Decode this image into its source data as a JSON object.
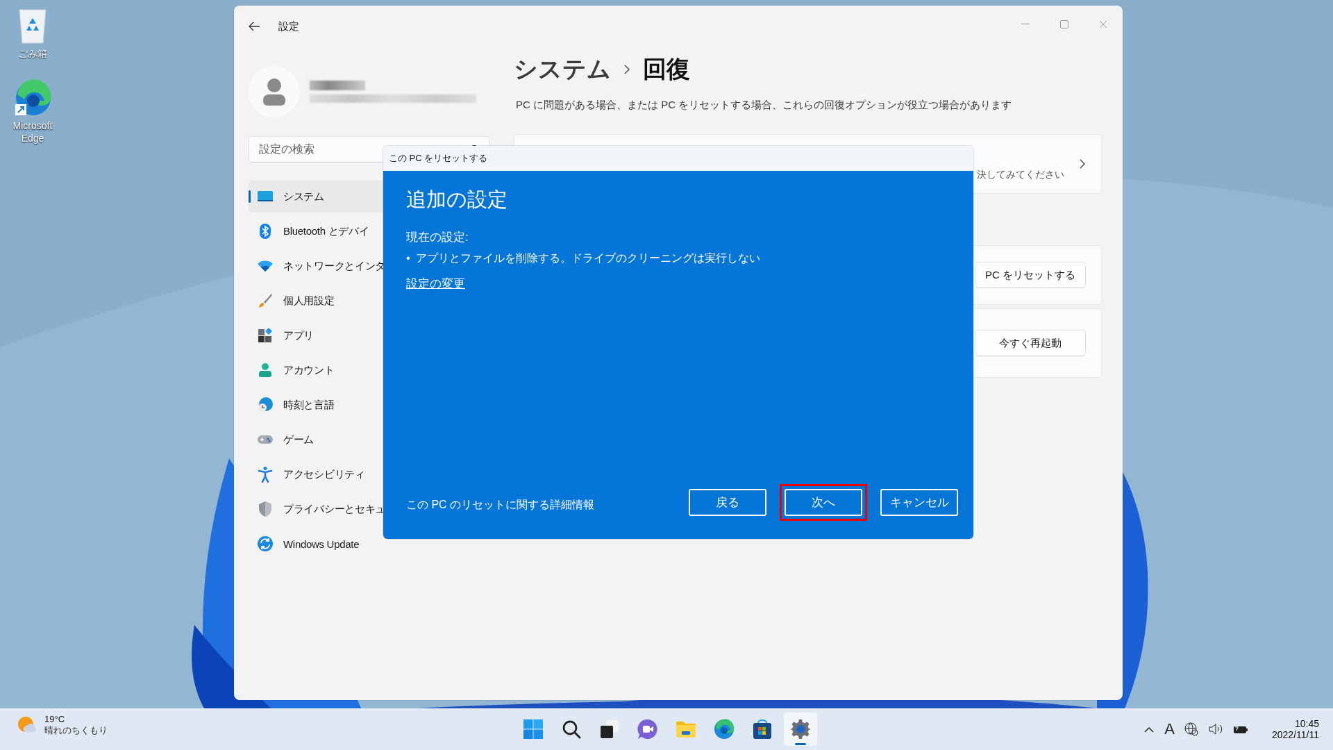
{
  "desktop_icons": [
    {
      "kind": "recycle",
      "label": "ごみ箱"
    },
    {
      "kind": "edge",
      "label": "Microsoft Edge"
    }
  ],
  "settings": {
    "title": "設定",
    "search": {
      "placeholder": "設定の検索"
    },
    "nav": [
      {
        "kind": "system",
        "label": "システム",
        "selected": true
      },
      {
        "kind": "bluetooth",
        "label": "Bluetooth とデバイ",
        "selected": false
      },
      {
        "kind": "network",
        "label": "ネットワークとインタ",
        "selected": false
      },
      {
        "kind": "brush",
        "label": "個人用設定",
        "selected": false
      },
      {
        "kind": "apps",
        "label": "アプリ",
        "selected": false
      },
      {
        "kind": "account",
        "label": "アカウント",
        "selected": false
      },
      {
        "kind": "time",
        "label": "時刻と言語",
        "selected": false
      },
      {
        "kind": "game",
        "label": "ゲーム",
        "selected": false
      },
      {
        "kind": "accessibility",
        "label": "アクセシビリティ",
        "selected": false
      },
      {
        "kind": "privacy",
        "label": "プライバシーとセキュ",
        "selected": false
      },
      {
        "kind": "update",
        "label": "Windows Update",
        "selected": false
      }
    ],
    "breadcrumb": [
      "システム",
      "回復"
    ],
    "description": "PC に問題がある場合、または PC をリセットする場合、これらの回復オプションが役立つ場合があります",
    "cards": [
      {
        "kind": "link",
        "text": "決してみてください"
      },
      {
        "kind": "button",
        "button": "PC をリセットする"
      },
      {
        "kind": "button",
        "button": "今すぐ再起動"
      }
    ]
  },
  "dialog": {
    "title": "この PC をリセットする",
    "heading": "追加の設定",
    "current_label": "現在の設定:",
    "bullets": [
      {
        "marker": "•",
        "text": "アプリとファイルを削除する。ドライブのクリーニングは実行しない"
      }
    ],
    "change_link": "設定の変更",
    "info_link": "この PC のリセットに関する詳細情報",
    "buttons": [
      {
        "label": "戻る",
        "highlighted": false
      },
      {
        "label": "次へ",
        "highlighted": true
      },
      {
        "label": "キャンセル",
        "highlighted": false
      }
    ]
  },
  "taskbar": {
    "weather": {
      "temperature": "19°C",
      "condition": "晴れのちくもり"
    },
    "apps": [
      {
        "kind": "start",
        "active": false
      },
      {
        "kind": "search",
        "active": false
      },
      {
        "kind": "taskview",
        "active": false
      },
      {
        "kind": "chat",
        "active": false
      },
      {
        "kind": "explorer",
        "active": false
      },
      {
        "kind": "edge",
        "active": false
      },
      {
        "kind": "store",
        "active": false
      },
      {
        "kind": "settings",
        "active": true
      }
    ],
    "ime": "A",
    "clock": {
      "time": "10:45",
      "date": "2022/11/11"
    }
  }
}
